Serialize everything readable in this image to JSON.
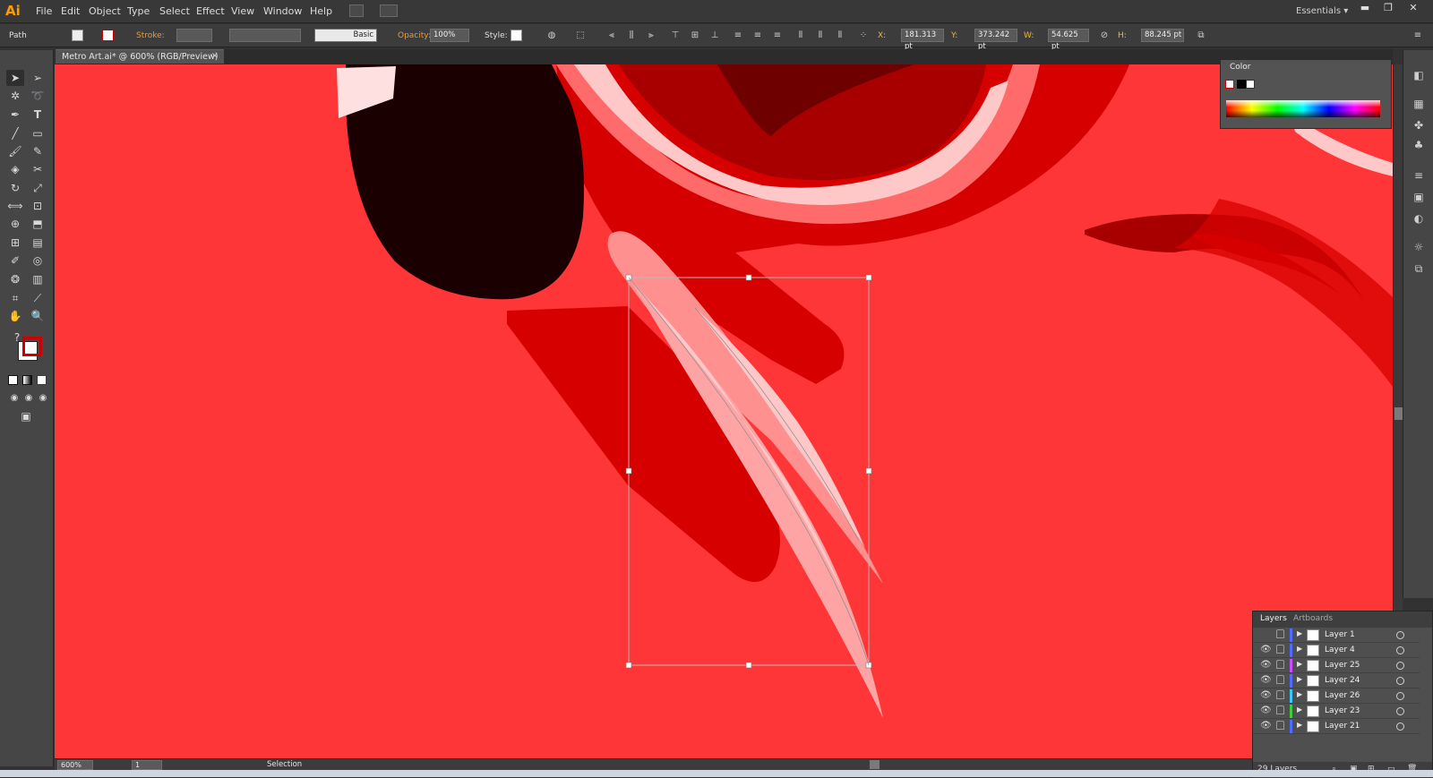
{
  "app": {
    "logo": "Ai"
  },
  "menu": [
    "File",
    "Edit",
    "Object",
    "Type",
    "Select",
    "Effect",
    "View",
    "Window",
    "Help"
  ],
  "workspace": {
    "label": "Essentials",
    "caret": "▾"
  },
  "window_controls": {
    "minimize": "▬",
    "restore": "❐",
    "close": "✕"
  },
  "control_bar": {
    "selection_type": "Path",
    "stroke_label": "Stroke:",
    "brush_label": "Basic",
    "opacity_label": "Opacity:",
    "opacity_value": "100%",
    "style_label": "Style:",
    "x_label": "X:",
    "x_value": "181.313 pt",
    "y_label": "Y:",
    "y_value": "373.242 pt",
    "w_label": "W:",
    "w_value": "54.625 pt",
    "h_label": "H:",
    "h_value": "88.245 pt"
  },
  "document_tab": {
    "title": "Metro Art.ai* @ 600% (RGB/Preview)",
    "close": "×"
  },
  "color_panel": {
    "title": "Color"
  },
  "layers_panel": {
    "tabs": [
      "Layers",
      "Artboards"
    ],
    "layers": [
      {
        "name": "Layer 1",
        "color": "#4f6cff",
        "visible": false
      },
      {
        "name": "Layer 4",
        "color": "#4f6cff",
        "visible": true
      },
      {
        "name": "Layer 25",
        "color": "#c84fff",
        "visible": true
      },
      {
        "name": "Layer 24",
        "color": "#4f6cff",
        "visible": true
      },
      {
        "name": "Layer 26",
        "color": "#3cc8ff",
        "visible": true
      },
      {
        "name": "Layer 23",
        "color": "#3ccf3c",
        "visible": true
      },
      {
        "name": "Layer 21",
        "color": "#4f6cff",
        "visible": true
      }
    ],
    "count": "29 Layers"
  },
  "status_bar": {
    "zoom": "600%",
    "page": "1",
    "tool": "Selection"
  },
  "colors": {
    "artboard_bg": "#fe3637",
    "dark_red": "#d70000",
    "deeper_red": "#a80000",
    "blackish": "#1a0000",
    "pink": "#ffa4a4",
    "light_pink": "#ffc8c8"
  }
}
